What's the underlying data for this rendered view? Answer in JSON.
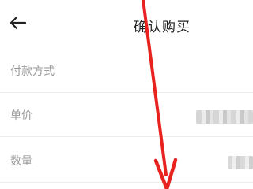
{
  "header": {
    "title": "确认购买",
    "back_icon": "back-arrow-icon"
  },
  "rows": [
    {
      "label": "付款方式"
    },
    {
      "label": "单价"
    },
    {
      "label": "数量"
    }
  ],
  "annotation": {
    "arrow_color": "#e8231f",
    "arrow_icon": "red-annotation-arrow"
  }
}
